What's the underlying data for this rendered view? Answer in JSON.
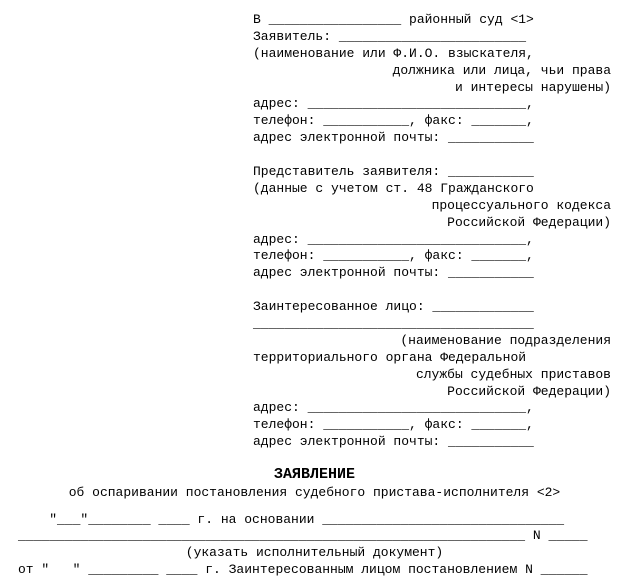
{
  "header": {
    "court_line": "В _________________ районный суд <1>",
    "blank_label": "",
    "applicant_label": "Заявитель: ________________________",
    "applicant_note1": "(наименование или Ф.И.О. взыскателя,",
    "applicant_note2": "должника или лица, чьи права",
    "applicant_note3": "и интересы нарушены)",
    "address_label": "адрес: ____________________________,",
    "phone_fax_label": "телефон: ___________, факс: _______,",
    "email_label": "адрес электронной почты: ___________",
    "rep_label": "Представитель заявителя: ___________",
    "rep_note1": "(данные с учетом ст. 48 Гражданского",
    "rep_note2": "процессуального кодекса",
    "rep_note3": "Российской Федерации)",
    "interested_label": "Заинтересованное лицо: _____________",
    "interested_blank": "____________________________________",
    "interested_note1": "(наименование подразделения",
    "interested_note2": "территориального органа Федеральной",
    "interested_note3": "службы судебных приставов",
    "interested_note4": "Российской Федерации)"
  },
  "title": "ЗАЯВЛЕНИЕ",
  "subtitle": "об оспаривании постановления судебного пристава-исполнителя <2>",
  "body": {
    "line1": "    \"___\"________ ____ г. на основании _______________________________",
    "line2": "_________________________________________________________________ N _____",
    "line2_note": "(указать исполнительный документ)",
    "line3": "от \"   \" _________ ____ г. Заинтересованным лицом постановлением N ______"
  }
}
